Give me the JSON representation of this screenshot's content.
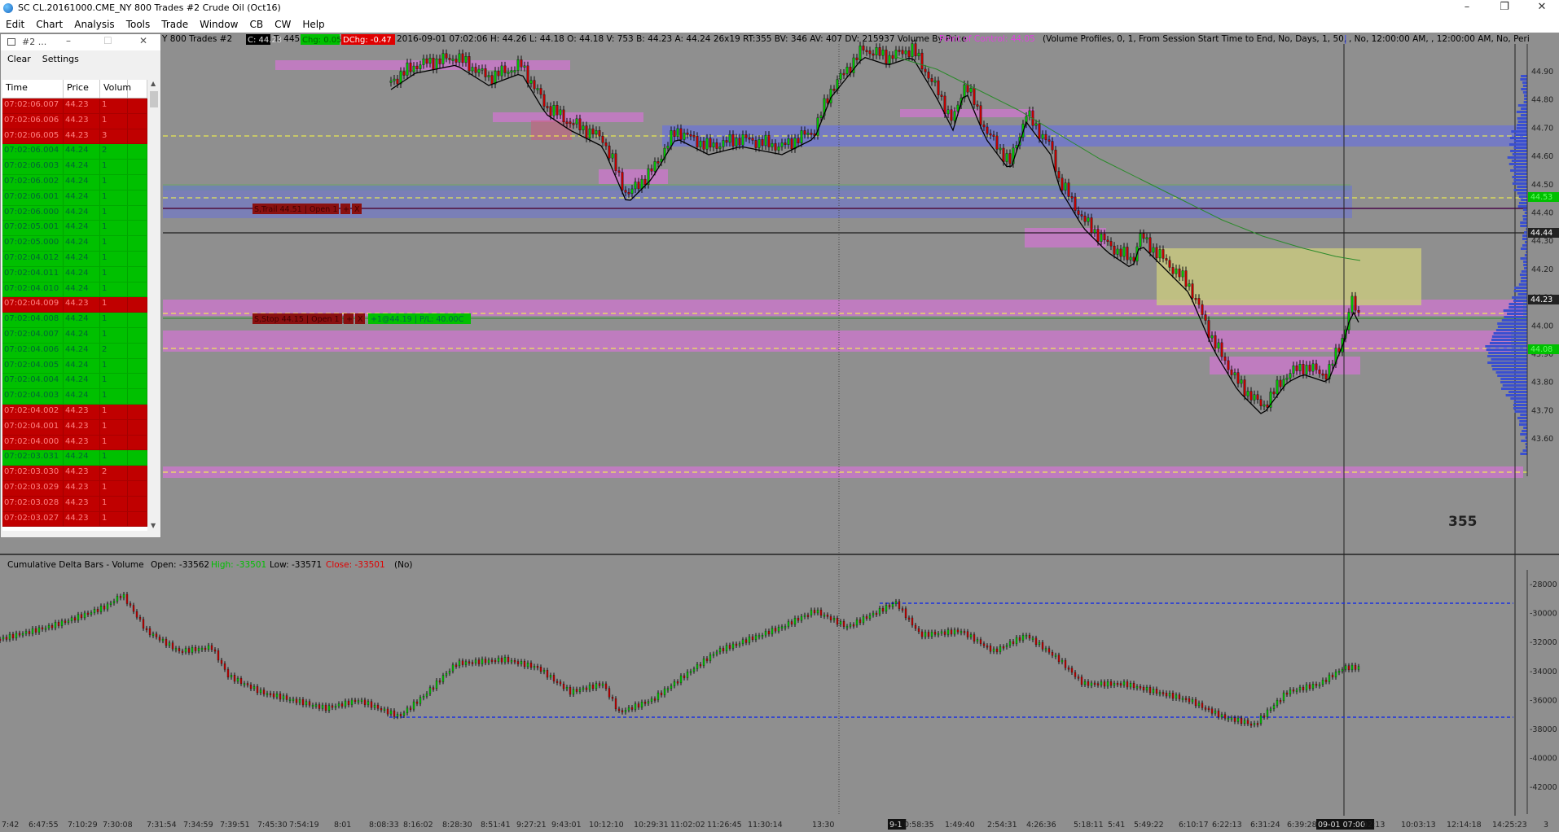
{
  "window": {
    "title": "SC CL.20161000.CME_NY  800 Trades  #2  Crude Oil (Oct16)",
    "minimize": "–",
    "restore": "❐",
    "close": "✕"
  },
  "menu": [
    "Edit",
    "Chart",
    "Analysis",
    "Tools",
    "Trade",
    "Window",
    "CB",
    "CW",
    "Help"
  ],
  "tsw": {
    "title": "#2 ...",
    "menu": [
      "Clear",
      "Settings"
    ],
    "columns": [
      "Time",
      "Price",
      "Volum"
    ],
    "rows": [
      {
        "time": "07:02:06.007",
        "price": "44.23",
        "vol": "1",
        "side": "sell"
      },
      {
        "time": "07:02:06.006",
        "price": "44.23",
        "vol": "1",
        "side": "sell"
      },
      {
        "time": "07:02:06.005",
        "price": "44.23",
        "vol": "3",
        "side": "sell"
      },
      {
        "time": "07:02:06.004",
        "price": "44.24",
        "vol": "2",
        "side": "buy"
      },
      {
        "time": "07:02:06.003",
        "price": "44.24",
        "vol": "1",
        "side": "buy"
      },
      {
        "time": "07:02:06.002",
        "price": "44.24",
        "vol": "1",
        "side": "buy"
      },
      {
        "time": "07:02:06.001",
        "price": "44.24",
        "vol": "1",
        "side": "buy"
      },
      {
        "time": "07:02:06.000",
        "price": "44.24",
        "vol": "1",
        "side": "buy"
      },
      {
        "time": "07:02:05.001",
        "price": "44.24",
        "vol": "1",
        "side": "buy"
      },
      {
        "time": "07:02:05.000",
        "price": "44.24",
        "vol": "1",
        "side": "buy"
      },
      {
        "time": "07:02:04.012",
        "price": "44.24",
        "vol": "1",
        "side": "buy"
      },
      {
        "time": "07:02:04.011",
        "price": "44.24",
        "vol": "1",
        "side": "buy"
      },
      {
        "time": "07:02:04.010",
        "price": "44.24",
        "vol": "1",
        "side": "buy"
      },
      {
        "time": "07:02:04.009",
        "price": "44.23",
        "vol": "1",
        "side": "sell"
      },
      {
        "time": "07:02:04.008",
        "price": "44.24",
        "vol": "1",
        "side": "buy"
      },
      {
        "time": "07:02:04.007",
        "price": "44.24",
        "vol": "1",
        "side": "buy"
      },
      {
        "time": "07:02:04.006",
        "price": "44.24",
        "vol": "2",
        "side": "buy"
      },
      {
        "time": "07:02:04.005",
        "price": "44.24",
        "vol": "1",
        "side": "buy"
      },
      {
        "time": "07:02:04.004",
        "price": "44.24",
        "vol": "1",
        "side": "buy"
      },
      {
        "time": "07:02:04.003",
        "price": "44.24",
        "vol": "1",
        "side": "buy"
      },
      {
        "time": "07:02:04.002",
        "price": "44.23",
        "vol": "1",
        "side": "sell"
      },
      {
        "time": "07:02:04.001",
        "price": "44.23",
        "vol": "1",
        "side": "sell"
      },
      {
        "time": "07:02:04.000",
        "price": "44.23",
        "vol": "1",
        "side": "sell"
      },
      {
        "time": "07:02:03.031",
        "price": "44.24",
        "vol": "1",
        "side": "buy"
      },
      {
        "time": "07:02:03.030",
        "price": "44.23",
        "vol": "2",
        "side": "sell"
      },
      {
        "time": "07:02:03.029",
        "price": "44.23",
        "vol": "1",
        "side": "sell"
      },
      {
        "time": "07:02:03.028",
        "price": "44.23",
        "vol": "1",
        "side": "sell"
      },
      {
        "time": "07:02:03.027",
        "price": "44.23",
        "vol": "1",
        "side": "sell"
      }
    ]
  },
  "main_header": {
    "prefix": "Y  800 Trades  #2",
    "c": "C: 44.23",
    "mid1": "T: 445",
    "chg": "Chg: 0.05",
    "dchg": "DChg: -0.47",
    "info": "2016-09-01 07:02:06  H: 44.26  L: 44.18  O: 44.18  V: 753  B: 44.23  A: 44.24  26x19  RT:355  BV: 346  AV: 407  DV: 215937  Volume By Price",
    "poc": "Point of Control: 44.05",
    "vp": "(Volume Profiles, 0, 1, From Session Start Time to End, No, Days, 1, 50, ",
    "vp2": "|",
    "vp3": ", No, 12:00:00 AM, , 12:00:00 AM, No, Peri"
  },
  "price_axis": [
    "44.90",
    "44.80",
    "44.70",
    "44.60",
    "44.50",
    "44.40",
    "44.30",
    "44.20",
    "44.10",
    "44.00",
    "43.90",
    "43.80",
    "43.70",
    "43.60"
  ],
  "price_markers": {
    "top_green": "44.53",
    "black": "44.44",
    "last": "44.23",
    "bottom_green": "44.08"
  },
  "orders": {
    "stop": "S,Trail 44.51 | Open 1 |",
    "stop_btn1": "+",
    "stop_btn2": "X",
    "target": "S,Stop 44.15 | Open 1 |",
    "target_btn1": "+",
    "target_btn2": "X",
    "position": "+1@44.19 | P/L: 40.00C"
  },
  "bar_countdown": "355",
  "delta": {
    "header_label": "Cumulative Delta Bars - Volume",
    "open": "Open: -33562",
    "high": "High: -33501",
    "low": "Low: -33571",
    "close": "Close: -33501",
    "tail": "(No)",
    "axis": [
      "-28000",
      "-30000",
      "-32000",
      "-34000",
      "-36000",
      "-38000",
      "-40000",
      "-42000"
    ]
  },
  "time_axis": [
    "7:42",
    "6:47:55",
    "7:10:29",
    "7:30:08",
    "7:31:54",
    "7:34:59",
    "7:39:51",
    "7:45:30",
    "7:54:19",
    "8:01",
    "8:08:33",
    "8:16:02",
    "8:28:30",
    "8:51:41",
    "9:27:21",
    "9:43:01",
    "10:12:10",
    "10:29:31",
    "11:02:02",
    "11:26:45",
    "11:30:14",
    "13:30",
    "9-1",
    "0:58:35",
    "1:49:40",
    "2:54:31",
    "4:26:36",
    "5:18:11",
    "5:41",
    "5:49:22",
    "6:10:17",
    "6:22:13",
    "6:31:24",
    "6:39:28",
    "09-01 07:00",
    "02:13",
    "10:03:13",
    "12:14:18",
    "14:25:23",
    "3"
  ],
  "colors": {
    "up": "#00c000",
    "down": "#c00000",
    "profile": "#3a4fd0",
    "zone_magenta": "#e070e0",
    "zone_blue": "#6a72d8",
    "dash_yellow": "#ffff40",
    "ma_black": "#000000",
    "ma_green": "#2a8a2a"
  }
}
